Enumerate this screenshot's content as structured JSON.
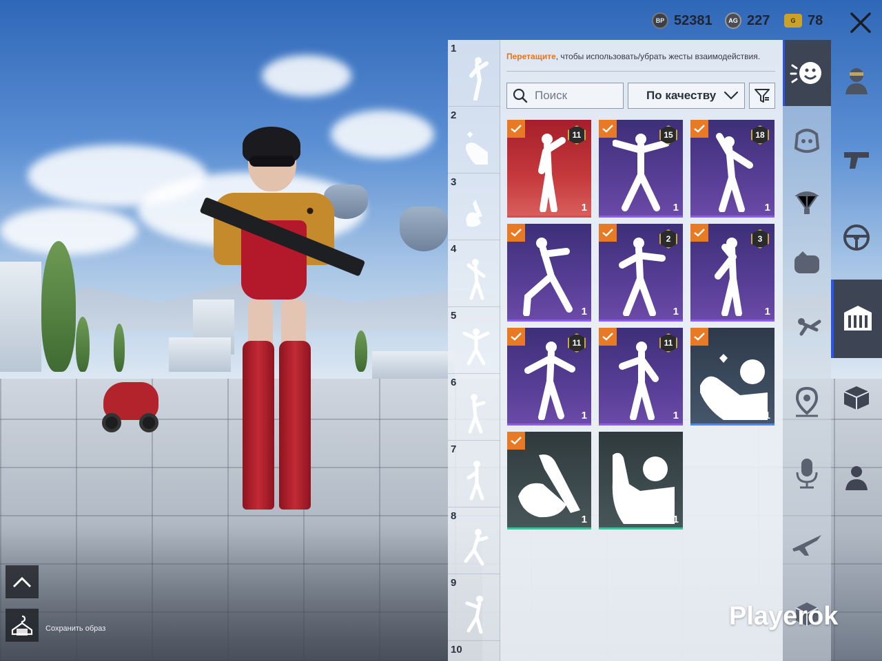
{
  "currency": {
    "bp": {
      "icon": "bp-coin-icon",
      "label": "BP",
      "value": "52381"
    },
    "ag": {
      "icon": "ag-coin-icon",
      "label": "AG",
      "value": "227"
    },
    "g": {
      "icon": "g-coin-icon",
      "label": "G",
      "value": "78"
    }
  },
  "close_icon": "close-icon",
  "slots": [
    "1",
    "2",
    "3",
    "4",
    "5",
    "6",
    "7",
    "8",
    "9",
    "10"
  ],
  "panel": {
    "hint_accent": "Перетащите",
    "hint_rest": ", чтобы использовать/убрать жесты взаимодействия.",
    "search_placeholder": "Поиск",
    "sort_label": "По качеству"
  },
  "emotes": [
    {
      "rarity": "red",
      "checked": true,
      "level": "11",
      "count": "1"
    },
    {
      "rarity": "purple",
      "checked": true,
      "level": "15",
      "count": "1"
    },
    {
      "rarity": "purple",
      "checked": true,
      "level": "18",
      "count": "1"
    },
    {
      "rarity": "purple",
      "checked": true,
      "level": "",
      "count": "1"
    },
    {
      "rarity": "purple",
      "checked": true,
      "level": "2",
      "count": "1"
    },
    {
      "rarity": "purple",
      "checked": true,
      "level": "3",
      "count": "1"
    },
    {
      "rarity": "purple",
      "checked": true,
      "level": "11",
      "count": "1"
    },
    {
      "rarity": "purple",
      "checked": true,
      "level": "11",
      "count": "1"
    },
    {
      "rarity": "blue",
      "checked": true,
      "level": "",
      "count": "1"
    },
    {
      "rarity": "green",
      "checked": true,
      "level": "",
      "count": "1"
    },
    {
      "rarity": "green",
      "checked": false,
      "level": "",
      "count": "1"
    }
  ],
  "tabs_left": [
    "emote-icon",
    "pet-icon",
    "parachute-icon",
    "chicken-icon",
    "skydive-icon",
    "marker-icon",
    "microphone-icon",
    "airplane-icon",
    "crate-icon"
  ],
  "tabs_right": [
    "avatar-icon",
    "gun-icon",
    "steering-wheel-icon",
    "outfit-icon",
    "box-icon",
    "people-icon"
  ],
  "bottom": {
    "save_label": "Сохранить образ"
  },
  "watermark": "Playerok",
  "colors": {
    "accent": "#e8741d",
    "selected_tab": "#2b55e6",
    "rarity_red": "#c63a3d",
    "rarity_purple": "#5a3f98"
  }
}
